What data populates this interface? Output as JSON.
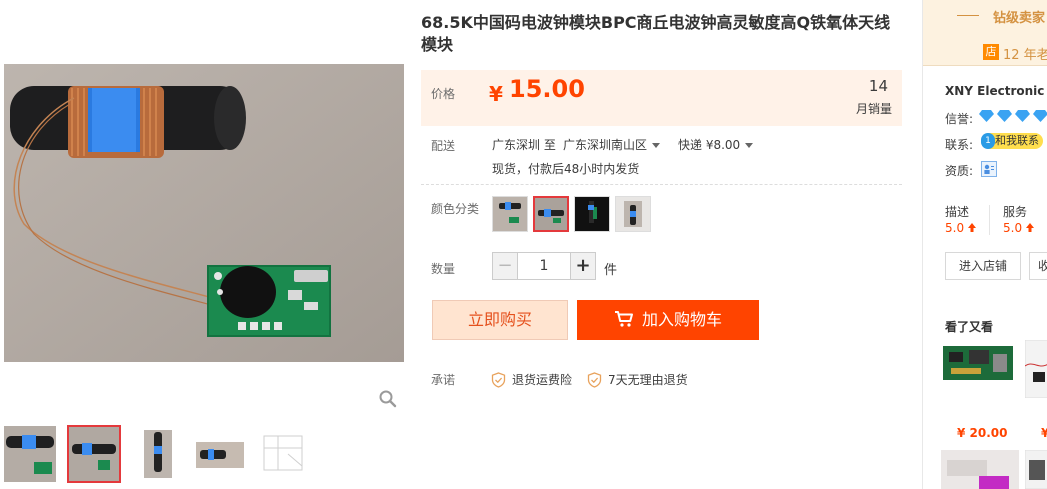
{
  "product": {
    "title": "68.5K中国码电波钟模块BPC商丘电波钟高灵敏度高Q铁氧体天线模块",
    "price_label": "价格",
    "price_symbol": "¥",
    "price": "15.00",
    "monthly_sales": "14",
    "monthly_sales_label": "月销量"
  },
  "shipping": {
    "label": "配送",
    "from": "广东深圳 至",
    "to": "广东深圳南山区",
    "method": "快递 ¥8.00",
    "note": "现货，付款后48小时内发货"
  },
  "options": {
    "color_label": "颜色分类",
    "colors": [
      "选项1",
      "选项2",
      "选项3",
      "选项4"
    ],
    "selected_color": 1
  },
  "quantity": {
    "label": "数量",
    "minus": "−",
    "plus": "+",
    "value": "1",
    "unit": "件"
  },
  "actions": {
    "buy_now": "立即购买",
    "add_to_cart": "加入购物车"
  },
  "promise": {
    "label": "承诺",
    "items": [
      "退货运费险",
      "7天无理由退货"
    ]
  },
  "gallery": {
    "thumb_count": 5,
    "active_thumb": 1
  },
  "shop": {
    "rank": "钻级卖家",
    "years_badge": "店",
    "years": "12 年老",
    "name": "XNY Electronic",
    "credit_label": "信誉:",
    "contact_label": "联系:",
    "contact_badge": "和我联系",
    "contact_dot": "1",
    "qualification_label": "资质:",
    "score_labels": [
      "描述",
      "服务"
    ],
    "score_values": [
      "5.0",
      "5.0"
    ],
    "enter_shop": "进入店铺",
    "collect_shop": "收",
    "see_also": "看了又看",
    "rec_price": "¥ 20.00",
    "rec_price2": "¥"
  },
  "colors": {
    "accent": "#ff4400",
    "price_bg": "#fff2e8",
    "selected_border": "#e4393c",
    "gold": "#d49241"
  }
}
